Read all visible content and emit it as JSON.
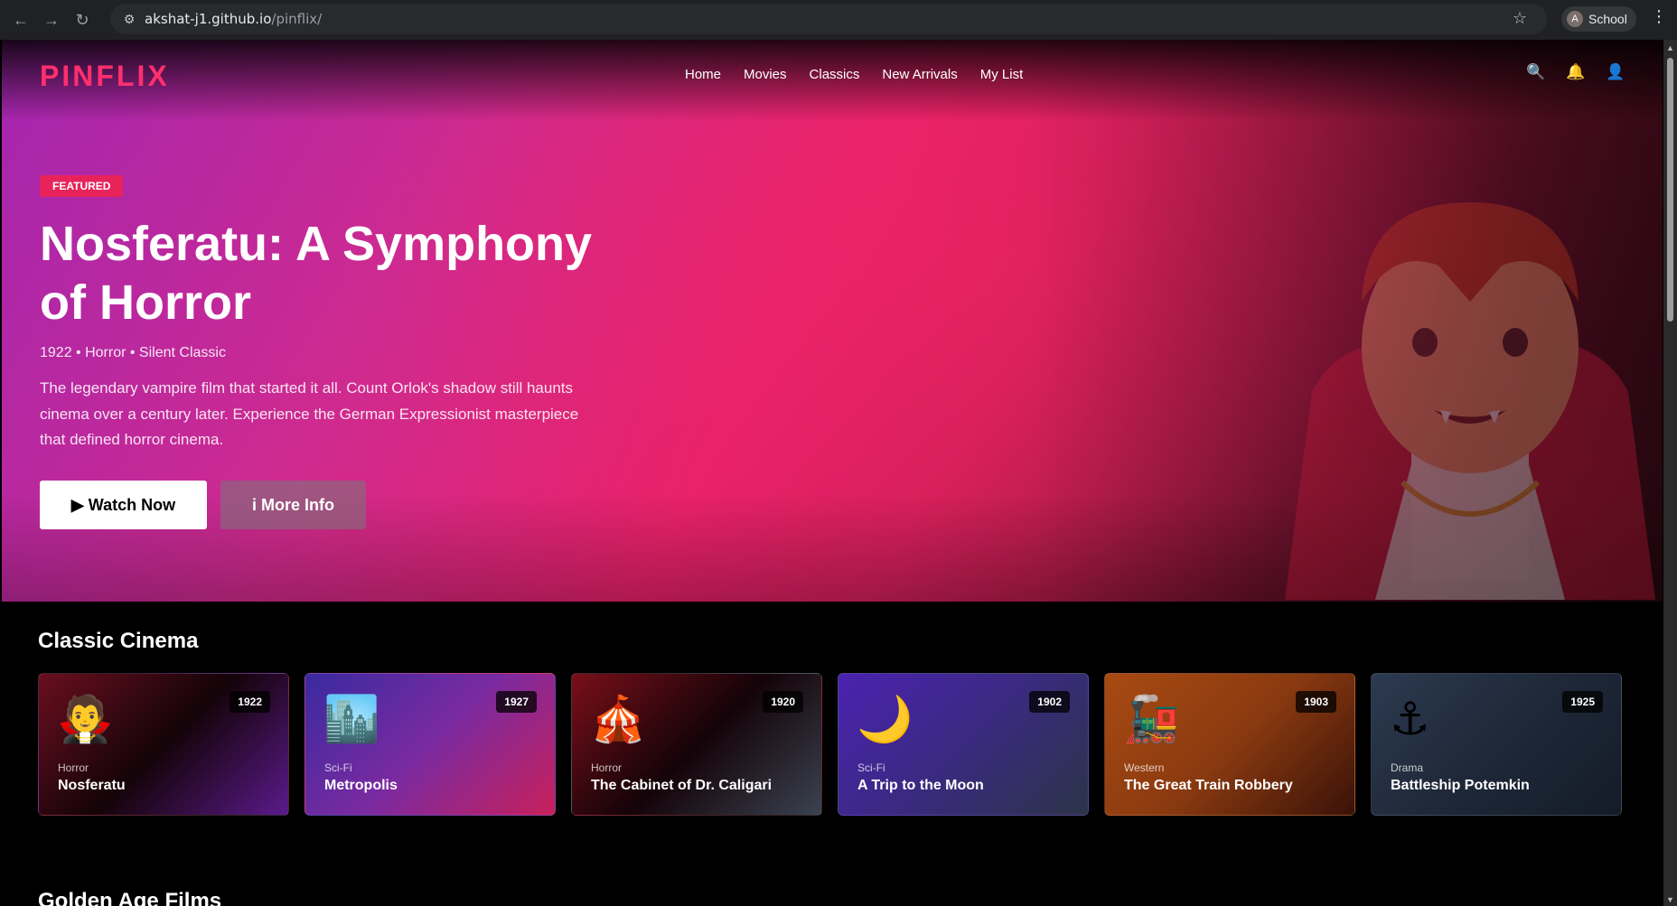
{
  "browser": {
    "url_host": "akshat-j1.github.io",
    "url_path": "/pinflix/",
    "profile_initial": "A",
    "profile_name": "School"
  },
  "site": {
    "logo": "PINFLIX",
    "nav": [
      "Home",
      "Movies",
      "Classics",
      "New Arrivals",
      "My List"
    ]
  },
  "hero": {
    "badge": "FEATURED",
    "title": "Nosferatu: A Symphony of Horror",
    "meta": "1922 • Horror • Silent Classic",
    "description": "The legendary vampire film that started it all. Count Orlok's shadow still haunts cinema over a century later. Experience the German Expressionist masterpiece that defined horror cinema.",
    "watch_label": "▶ Watch Now",
    "info_label": "i More Info"
  },
  "sections": {
    "classic_title": "Classic Cinema",
    "golden_title": "Golden Age Films"
  },
  "cards": [
    {
      "emoji": "🧛",
      "year": "1922",
      "genre": "Horror",
      "title": "Nosferatu"
    },
    {
      "emoji": "🏙️",
      "year": "1927",
      "genre": "Sci-Fi",
      "title": "Metropolis"
    },
    {
      "emoji": "🎪",
      "year": "1920",
      "genre": "Horror",
      "title": "The Cabinet of Dr. Caligari"
    },
    {
      "emoji": "🌙",
      "year": "1902",
      "genre": "Sci-Fi",
      "title": "A Trip to the Moon"
    },
    {
      "emoji": "🚂",
      "year": "1903",
      "genre": "Western",
      "title": "The Great Train Robbery"
    },
    {
      "emoji": "⚓",
      "year": "1925",
      "genre": "Drama",
      "title": "Battleship Potemkin"
    }
  ],
  "colors": {
    "brand": "#ff2f6e",
    "badge": "#e8235a",
    "card_backgrounds": [
      "linear-gradient(135deg, #6b0f1f 0%, #140308 50%, #5a1a8a 100%)",
      "linear-gradient(135deg, #3a2aa0 0%, #7a2aa0 50%, #c8205a 100%)",
      "linear-gradient(135deg, #7a0f1a 0%, #140308 50%, #3a4250 100%)",
      "linear-gradient(135deg, #4a22b0 0%, #3a2a80 50%, #2c3448 100%)",
      "linear-gradient(135deg, #a84a12 0%, #8a3a10 50%, #3a1208 100%)",
      "linear-gradient(135deg, #2c3a50 0%, #1e2838 50%, #141c28 100%)"
    ]
  }
}
